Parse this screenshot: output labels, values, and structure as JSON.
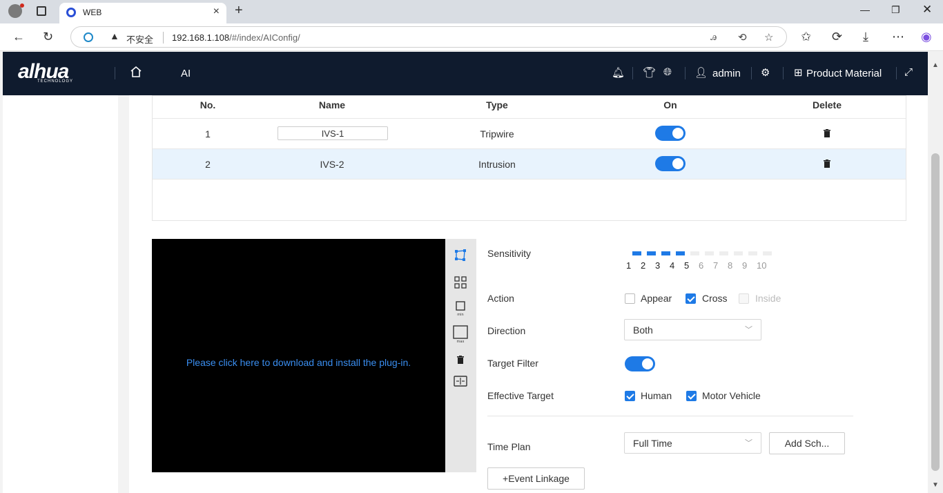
{
  "browser": {
    "tab_title": "WEB",
    "security_label": "不安全",
    "url_host": "192.168.1.108",
    "url_path": "/#/index/AIConfig/"
  },
  "header": {
    "logo": "alhua",
    "logo_sub": "TECHNOLOGY",
    "nav_ai": "AI",
    "user": "admin",
    "product_material": "Product Material"
  },
  "rules_table": {
    "columns": [
      "No.",
      "Name",
      "Type",
      "On",
      "Delete"
    ],
    "rows": [
      {
        "no": "1",
        "name": "IVS-1",
        "type": "Tripwire",
        "on": true
      },
      {
        "no": "2",
        "name": "IVS-2",
        "type": "Intrusion",
        "on": true
      }
    ]
  },
  "video": {
    "plugin_message": "Please click here to download and install the plug-in."
  },
  "tools": [
    "draw-rule-icon",
    "grid-icon",
    "min-size-icon",
    "max-size-icon",
    "clear-icon",
    "pixel-counter-icon"
  ],
  "settings": {
    "sensitivity_label": "Sensitivity",
    "sensitivity_value": 5,
    "sensitivity_ticks": [
      "1",
      "2",
      "3",
      "4",
      "5",
      "6",
      "7",
      "8",
      "9",
      "10"
    ],
    "action_label": "Action",
    "action_appear": "Appear",
    "action_cross": "Cross",
    "action_inside": "Inside",
    "direction_label": "Direction",
    "direction_value": "Both",
    "target_filter_label": "Target Filter",
    "effective_target_label": "Effective Target",
    "target_human": "Human",
    "target_motor": "Motor Vehicle",
    "time_plan_label": "Time Plan",
    "time_plan_value": "Full Time",
    "add_schedule": "Add Sch...",
    "event_linkage": "+Event Linkage"
  },
  "colors": {
    "accent": "#1e7ae6",
    "header_bg": "#0f1b2e",
    "link": "#3a8ef0"
  }
}
